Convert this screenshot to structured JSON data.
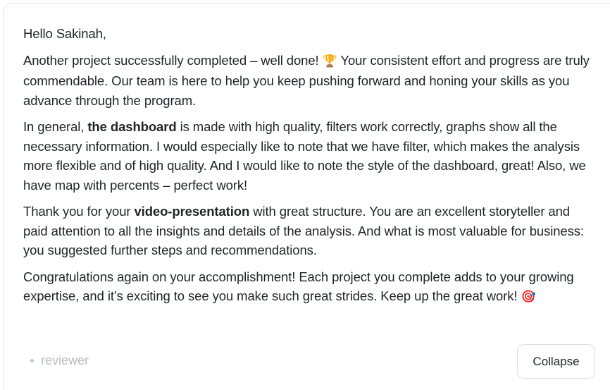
{
  "message": {
    "greeting": "Hello Sakinah,",
    "p1_text1": "Another project successfully completed – well done! ",
    "p1_emoji": "🏆",
    "p1_text2": " Your consistent effort and progress are truly commendable. Our team is here to help you keep pushing forward and honing your skills as you advance through the program.",
    "p2_text1": "In general, ",
    "p2_bold": "the dashboard",
    "p2_text2": " is made with high quality, filters work correctly, graphs show all the necessary information. I would especially like to note that we have filter, which makes the analysis more flexible and of high quality. And I would like to note the style of the dashboard, great! Also, we have map with percents – perfect work!",
    "p3_text1": "Thank you for your ",
    "p3_bold": "video-presentation",
    "p3_text2": " with great structure. You are an excellent storyteller and paid attention to all the insights and details of the analysis. And what is most valuable for business: you suggested further steps and recommendations.",
    "p4_text1": "Congratulations again on your accomplishment! Each project you complete adds to your growing expertise, and it’s exciting to see you make such great strides. Keep up the great work! ",
    "p4_emoji": "🎯"
  },
  "footer": {
    "author_label": "reviewer",
    "collapse_label": "Collapse"
  }
}
